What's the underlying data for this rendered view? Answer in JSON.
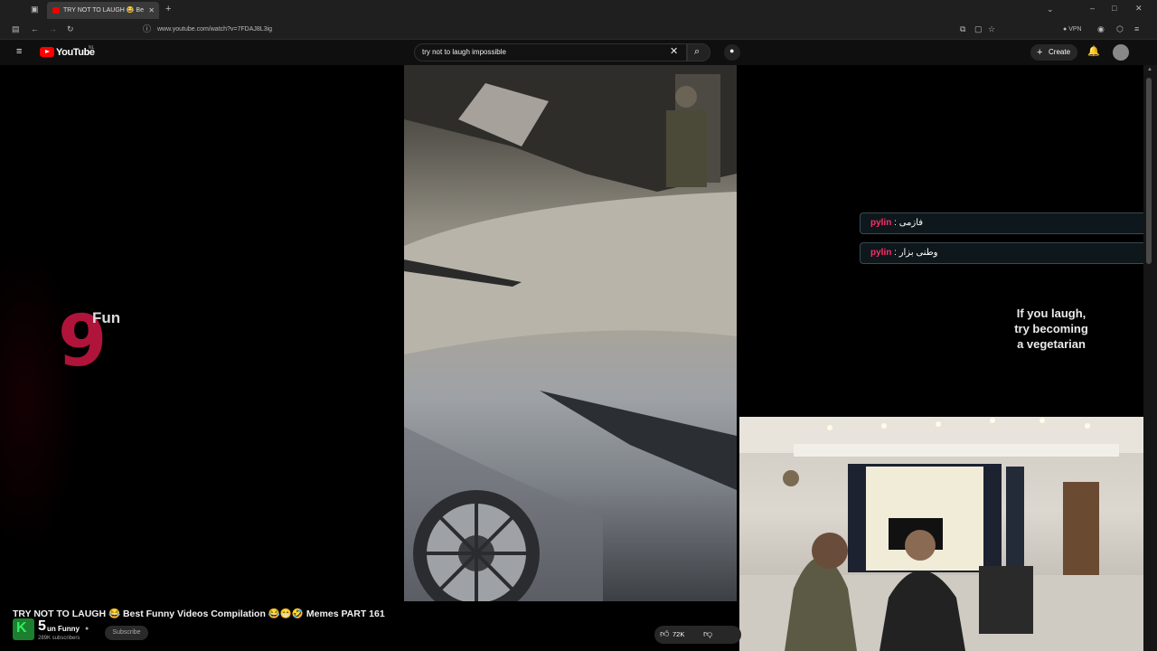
{
  "browser": {
    "tab_title": "TRY NOT TO LAUGH 😂 Be",
    "url": "www.youtube.com/watch?v=7FDAJ8L3ig",
    "vpn_label": "VPN"
  },
  "youtube": {
    "logo_text": "YouTube",
    "logo_sup": "NL",
    "search_value": "try not to laugh impossible",
    "create_label": "Create"
  },
  "video": {
    "brand_number": "9",
    "brand_text": "Fun",
    "chat": [
      {
        "user": "pylin",
        "message": "فازمی"
      },
      {
        "user": "pylin",
        "message": "وطنی بزار"
      }
    ],
    "laugh_text": "If you laugh, try becoming a vegetarian"
  },
  "meta": {
    "title": "TRY NOT TO LAUGH 😂 Best Funny Videos Compilation 😂😁🤣 Memes PART 161",
    "channel_overlay_number": "5",
    "channel_name": "un Funny",
    "subscribers": "289K subscribers",
    "subscribe_label": "Subscribe",
    "likes": "72K"
  },
  "colors": {
    "youtube_red": "#ff0000",
    "chat_user": "#ff2d6a",
    "brand_pink": "#b0143a"
  }
}
